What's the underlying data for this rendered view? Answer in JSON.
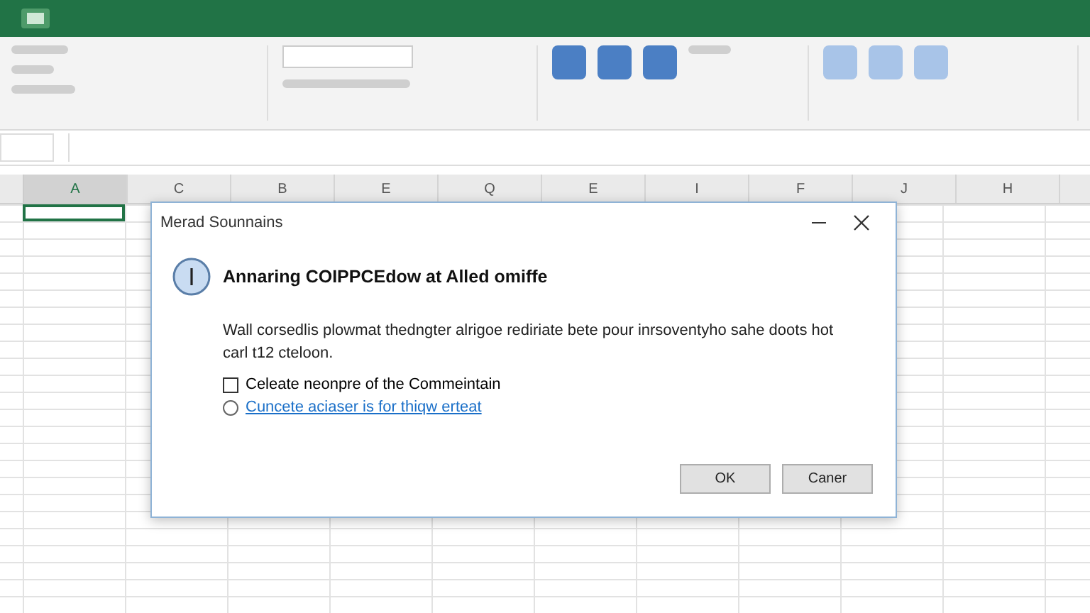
{
  "sheet": {
    "columns": [
      {
        "label": "A",
        "selected": true
      },
      {
        "label": "C",
        "selected": false
      },
      {
        "label": "B",
        "selected": false
      },
      {
        "label": "E",
        "selected": false
      },
      {
        "label": "Q",
        "selected": false
      },
      {
        "label": "E",
        "selected": false
      },
      {
        "label": "I",
        "selected": false
      },
      {
        "label": "F",
        "selected": false
      },
      {
        "label": "J",
        "selected": false
      },
      {
        "label": "H",
        "selected": false
      }
    ]
  },
  "dialog": {
    "title": "Merad Sounnains",
    "heading": "Annaring COIPPCEdow at Alled omiffe",
    "message": "Wall corsedlis plowmat thedngter alrigoe rediriate bete pour inrsoventyho sahe doots hot carl t12 cteloon.",
    "options": [
      {
        "kind": "checkbox",
        "label": "Celeate neonpre of the Commeintain",
        "checked": false
      },
      {
        "kind": "radio",
        "label": "Cuncete aciaser is for thiqw erteat",
        "selected": false
      }
    ],
    "buttons": [
      "OK",
      "Caner"
    ]
  }
}
